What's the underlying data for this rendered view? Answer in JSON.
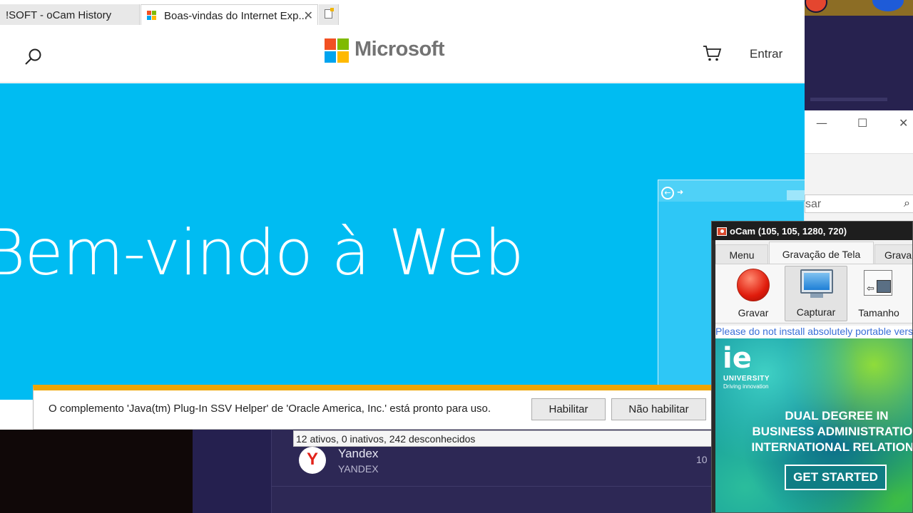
{
  "browser": {
    "tabs": [
      {
        "label": "!SOFT - oCam History",
        "active": false
      },
      {
        "label": "Boas-vindas do Internet Exp...",
        "active": true
      }
    ]
  },
  "ms_page": {
    "logo_text": "Microsoft",
    "signin_label": "Entrar",
    "hero_title": "Bem-vindo à Web"
  },
  "notification": {
    "message": "O complemento 'Java(tm) Plug-In SSV Helper' de 'Oracle America, Inc.' está pronto para uso.",
    "enable_label": "Habilitar",
    "disable_label": "Não habilitar"
  },
  "addon_status": "12 ativos, 0 inativos, 242 desconhecidos",
  "background_list": {
    "item_name": "Yandex",
    "item_sub": "YANDEX",
    "item_number": "10"
  },
  "explorer": {
    "search_placeholder": "sar"
  },
  "ocam": {
    "title": "oCam (105, 105, 1280, 720)",
    "tabs": [
      "Menu",
      "Gravação de Tela",
      "Grava"
    ],
    "tools": [
      "Gravar",
      "Capturar",
      "Tamanho"
    ],
    "notice": "Please do not install absolutely portable vers",
    "ad": {
      "brand": "ie",
      "brand_sub": "UNIVERSITY",
      "brand_tagline": "Driving innovation",
      "headline_1": "DUAL DEGREE IN",
      "headline_2": "BUSINESS ADMINISTRATION",
      "headline_3": "INTERNATIONAL RELATIONS",
      "cta": "GET STARTED"
    }
  },
  "colors": {
    "hero_blue": "#00bcf2",
    "notify_accent": "#f0a500",
    "ms_red": "#f25022",
    "ms_green": "#7fba00",
    "ms_blue": "#00a4ef",
    "ms_yellow": "#ffb900"
  }
}
